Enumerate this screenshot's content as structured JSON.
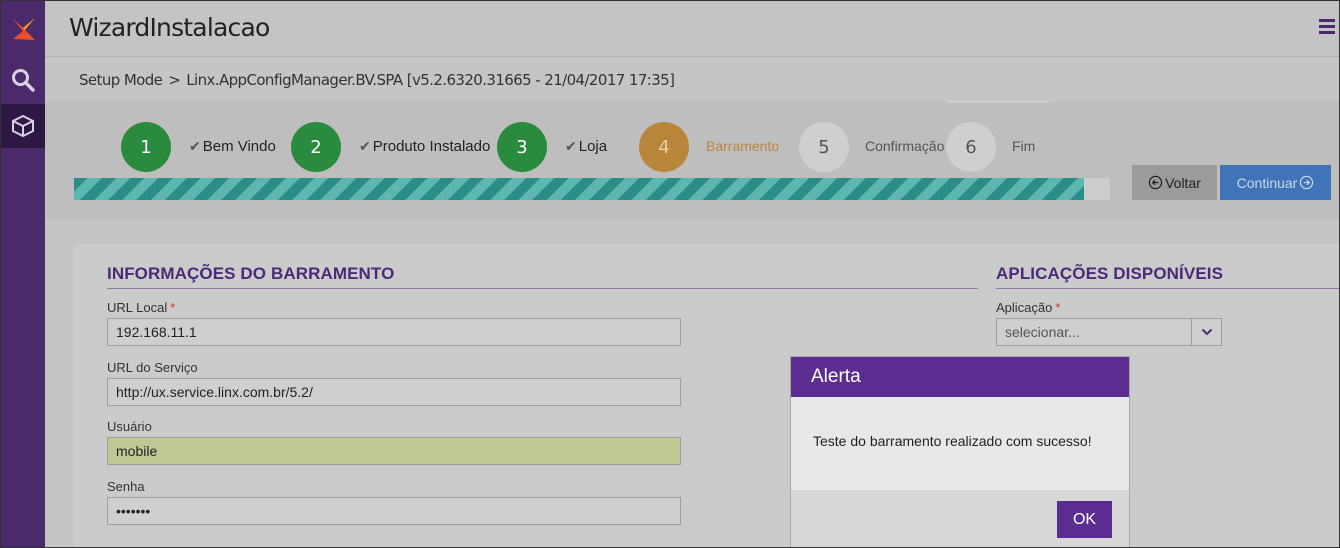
{
  "header": {
    "title": "WizardInstalacao",
    "menu_icon": "hamburger-icon"
  },
  "rail": {
    "icons": [
      "logo-icon",
      "search-icon",
      "box-icon"
    ]
  },
  "breadcrumb": {
    "items": [
      "Setup Mode",
      "Linx.AppConfigManager.BV.SPA [v5.2.6320.31665 - 21/04/2017 17:35]"
    ],
    "separator": ">"
  },
  "wizard": {
    "steps": [
      {
        "number": "1",
        "label": "Bem Vindo",
        "state": "done"
      },
      {
        "number": "2",
        "label": "Produto Instalado",
        "state": "done"
      },
      {
        "number": "3",
        "label": "Loja",
        "state": "done"
      },
      {
        "number": "4",
        "label": "Barramento",
        "state": "current"
      },
      {
        "number": "5",
        "label": "Confirmação",
        "state": "todo"
      },
      {
        "number": "6",
        "label": "Fim",
        "state": "todo"
      }
    ],
    "progress_fraction": 0.975,
    "back_label": "Voltar",
    "next_label": "Continuar"
  },
  "form": {
    "left_title": "INFORMAÇÕES DO BARRAMENTO",
    "right_title": "APLICAÇÕES DISPONÍVEIS",
    "url_local": {
      "label": "URL Local",
      "required_mark": "*",
      "value": "192.168.11.1"
    },
    "url_servico": {
      "label": "URL do Serviço",
      "value": "http://ux.service.linx.com.br/5.2/"
    },
    "usuario": {
      "label": "Usuário",
      "value": "mobile"
    },
    "senha": {
      "label": "Senha",
      "value": "•••••••"
    },
    "aplicacao": {
      "label": "Aplicação",
      "required_mark": "*",
      "selected": "selecionar..."
    }
  },
  "alert": {
    "title": "Alerta",
    "message": "Teste do barramento realizado com sucesso!",
    "ok_label": "OK"
  },
  "colors": {
    "purple": "#5c2d91",
    "step_done": "#2a8a3e",
    "step_current": "#b8863a",
    "progress": "#2c8c86",
    "continue_blue": "#3f74b8"
  }
}
